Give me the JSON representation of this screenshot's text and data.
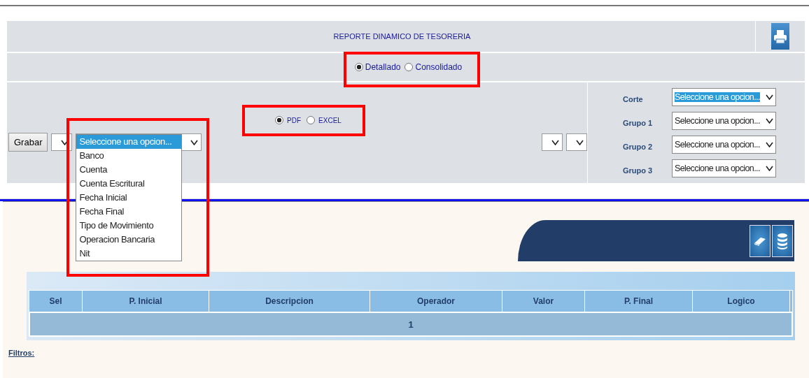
{
  "header": {
    "title": "REPORTE DINAMICO DE TESORERIA"
  },
  "report_type": [
    {
      "label": "Detallado",
      "selected": true
    },
    {
      "label": "Consolidado",
      "selected": false
    }
  ],
  "format": [
    {
      "label": "PDF",
      "selected": true
    },
    {
      "label": "EXCEL",
      "selected": false
    }
  ],
  "save_button": "Grabar",
  "field_dropdown": {
    "options": [
      {
        "label": "Seleccione una opcion...",
        "selected": true
      },
      {
        "label": "Banco",
        "selected": false
      },
      {
        "label": "Cuenta",
        "selected": false
      },
      {
        "label": "Cuenta Escritural",
        "selected": false
      },
      {
        "label": "Fecha Inicial",
        "selected": false
      },
      {
        "label": "Fecha Final",
        "selected": false
      },
      {
        "label": "Tipo de Movimiento",
        "selected": false
      },
      {
        "label": "Operacion Bancaria",
        "selected": false
      },
      {
        "label": "Nit",
        "selected": false
      }
    ]
  },
  "grouping": [
    {
      "label": "Corte",
      "value": "Seleccione una opcion...",
      "focused": true
    },
    {
      "label": "Grupo 1",
      "value": "Seleccione una opcion...",
      "focused": false
    },
    {
      "label": "Grupo 2",
      "value": "Seleccione una opcion...",
      "focused": false
    },
    {
      "label": "Grupo 3",
      "value": "Seleccione una opcion...",
      "focused": false
    }
  ],
  "table": {
    "columns": [
      "Sel",
      "P. Inicial",
      "Descripcion",
      "Operador",
      "Valor",
      "P. Final",
      "Logico"
    ],
    "pager": "1"
  },
  "filters_label": "Filtros:"
}
